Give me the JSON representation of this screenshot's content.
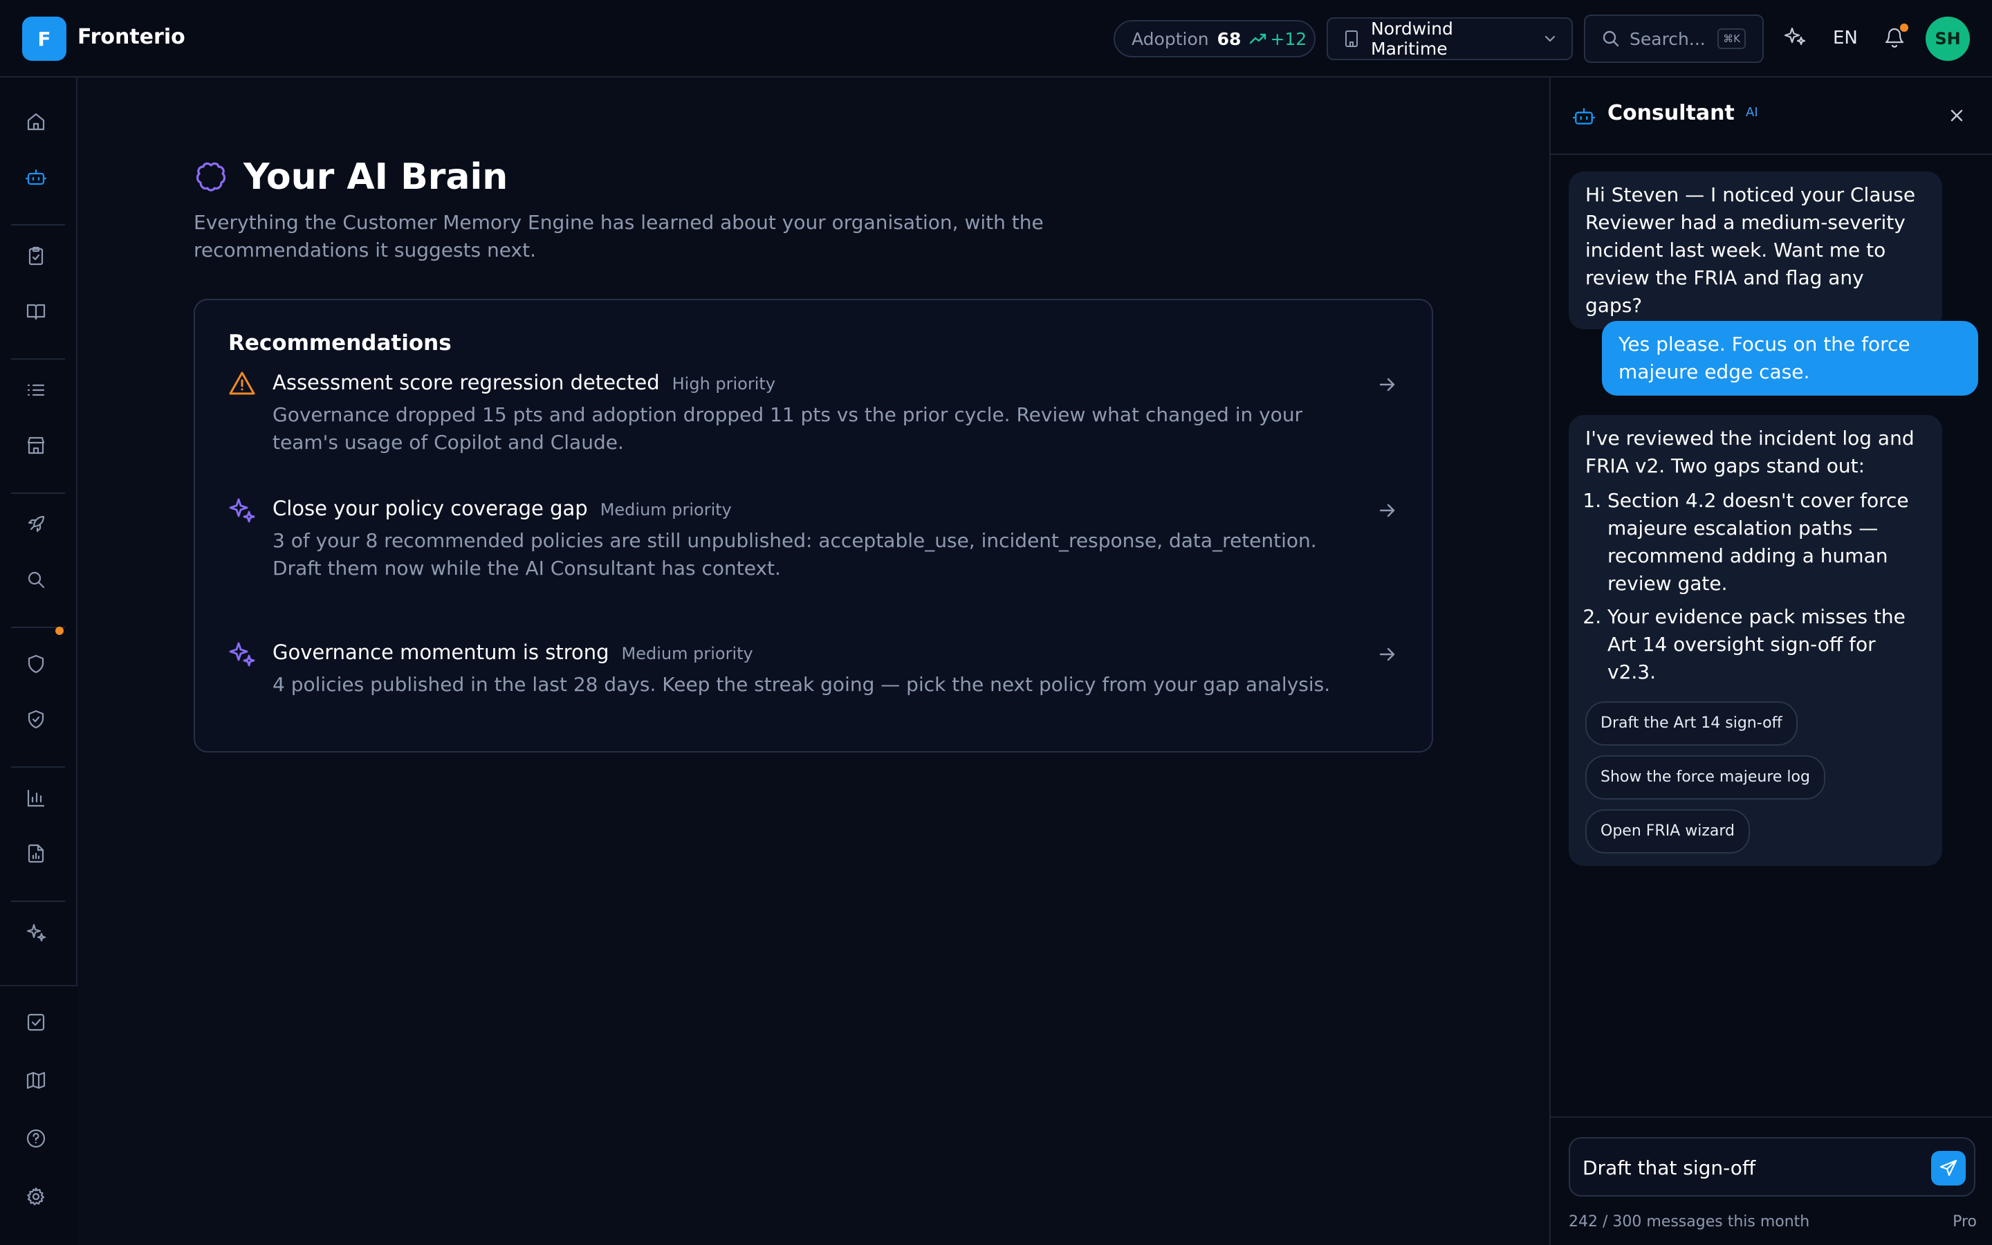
{
  "app": {
    "logo_letter": "F",
    "name": "Fronterio"
  },
  "header": {
    "adoption_label": "Adoption",
    "adoption_value": "68",
    "adoption_delta": "+12",
    "org_name": "Nordwind Maritime",
    "search_placeholder": "Search...",
    "search_shortcut": "⌘K",
    "language": "EN",
    "avatar_initials": "SH"
  },
  "sidebar": {
    "items": [
      "home-icon",
      "bot-icon",
      "clipboard-check-icon",
      "book-icon",
      "list-icon",
      "store-icon",
      "rocket-icon",
      "search-icon",
      "shield-icon",
      "shield-check-icon",
      "bar-chart-icon",
      "file-chart-icon",
      "sparkles-icon",
      "check-square-icon",
      "map-icon",
      "help-circle-icon",
      "settings-icon"
    ],
    "active": "bot-icon"
  },
  "main": {
    "title": "Your AI Brain",
    "subtitle": "Everything the Customer Memory Engine has learned about your organisation, with the recommendations it suggests next.",
    "recommendations_heading": "Recommendations",
    "recommendations": [
      {
        "icon": "warning-triangle-icon",
        "title": "Assessment score regression detected",
        "priority": "High priority",
        "description": "Governance dropped 15 pts and adoption dropped 11 pts vs the prior cycle. Review what changed in your team's usage of Copilot and Claude."
      },
      {
        "icon": "sparkles-icon",
        "title": "Close your policy coverage gap",
        "priority": "Medium priority",
        "description": "3 of your 8 recommended policies are still unpublished: acceptable_use, incident_response, data_retention. Draft them now while the AI Consultant has context."
      },
      {
        "icon": "sparkles-icon",
        "title": "Governance momentum is strong",
        "priority": "Medium priority",
        "description": "4 policies published in the last 28 days. Keep the streak going — pick the next policy from your gap analysis."
      }
    ]
  },
  "consultant": {
    "title": "Consultant",
    "badge": "AI",
    "messages": [
      {
        "role": "ai",
        "text": "Hi Steven — I noticed your Clause Reviewer had a medium-severity incident last week. Want me to review the FRIA and flag any gaps?"
      },
      {
        "role": "user",
        "text": "Yes please. Focus on the force majeure edge case."
      },
      {
        "role": "ai",
        "text": "I've reviewed the incident log and FRIA v2. Two gaps stand out:",
        "items": [
          "Section 4.2 doesn't cover force majeure escalation paths — recommend adding a human review gate.",
          "Your evidence pack misses the Art 14 oversight sign-off for v2.3."
        ],
        "chips": [
          "Draft the Art 14 sign-off",
          "Show the force majeure log",
          "Open FRIA wizard"
        ]
      }
    ],
    "input_value": "Draft that sign-off",
    "usage": "242 / 300 messages this month",
    "plan": "Pro"
  },
  "colors": {
    "accent": "#1a95f2",
    "warning": "#f08a24",
    "sparkle": "#8b6cf6",
    "success": "#22c3a0",
    "avatar": "#10b981"
  }
}
